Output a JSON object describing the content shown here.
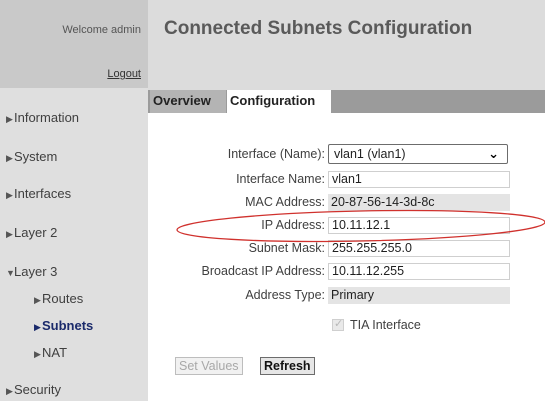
{
  "sidebar": {
    "welcome": "Welcome admin",
    "logout": "Logout",
    "items": [
      {
        "label": "Information"
      },
      {
        "label": "System"
      },
      {
        "label": "Interfaces"
      },
      {
        "label": "Layer 2"
      },
      {
        "label": "Layer 3"
      },
      {
        "label": "Routes"
      },
      {
        "label": "Subnets"
      },
      {
        "label": "NAT"
      },
      {
        "label": "Security"
      }
    ],
    "active_item": "Subnets",
    "active_color": "#1a2a6b"
  },
  "header": {
    "title": "Connected Subnets Configuration"
  },
  "tabs": [
    {
      "label": "Overview"
    },
    {
      "label": "Configuration"
    }
  ],
  "active_tab": "Configuration",
  "form": {
    "interface_select": {
      "label": "Interface (Name):",
      "value": "vlan1 (vlan1)"
    },
    "interface_name": {
      "label": "Interface Name:",
      "value": "vlan1"
    },
    "mac_address": {
      "label": "MAC Address:",
      "value": "20-87-56-14-3d-8c"
    },
    "ip_address": {
      "label": "IP Address:",
      "value": "10.11.12.1"
    },
    "subnet_mask": {
      "label": "Subnet Mask:",
      "value": "255.255.255.0"
    },
    "broadcast_ip": {
      "label": "Broadcast IP Address:",
      "value": "10.11.12.255"
    },
    "address_type": {
      "label": "Address Type:",
      "value": "Primary"
    },
    "tia_interface": {
      "label": "TIA Interface",
      "checked": true,
      "disabled": true
    }
  },
  "buttons": {
    "set_values": "Set Values",
    "refresh": "Refresh"
  },
  "annotation": {
    "shape": "ellipse",
    "color": "#d0312d",
    "highlights": "IP Address"
  }
}
